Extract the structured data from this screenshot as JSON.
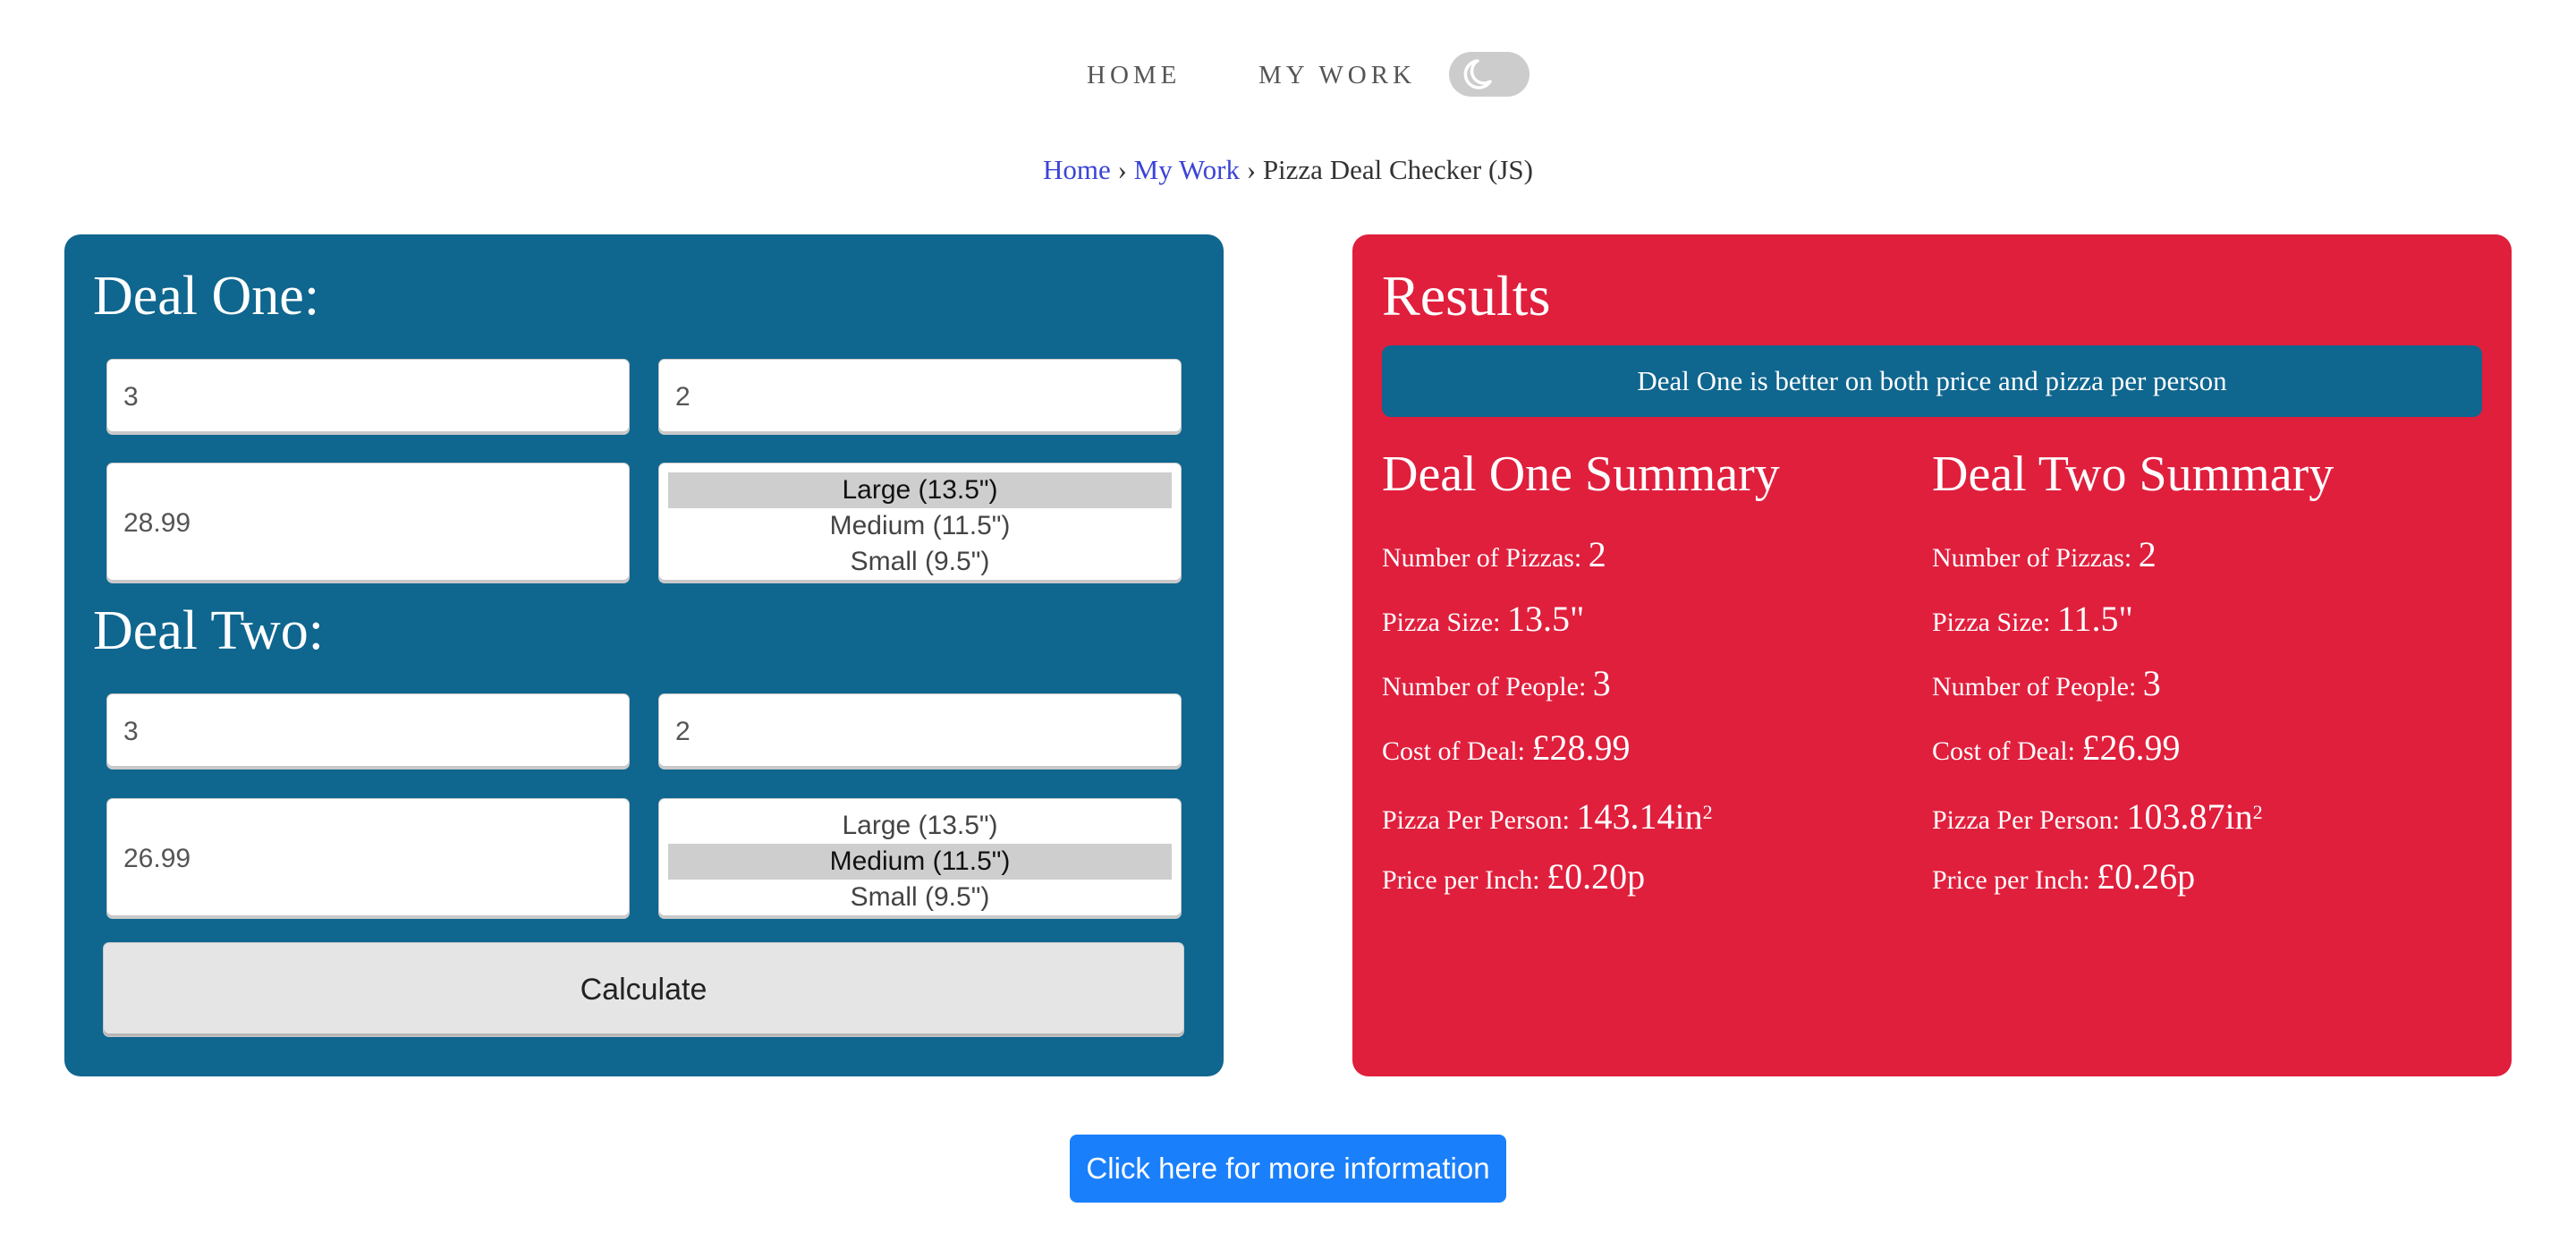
{
  "nav": {
    "items": [
      {
        "label": "HOME"
      },
      {
        "label": "MY WORK"
      }
    ],
    "theme_toggle_icon": "moon-icon"
  },
  "breadcrumb": {
    "items": [
      {
        "label": "Home",
        "link": true
      },
      {
        "label": "My Work",
        "link": true
      },
      {
        "label": "Pizza Deal Checker (JS)",
        "link": false
      }
    ],
    "separator": "›"
  },
  "deal_one": {
    "title": "Deal One:",
    "people": "3",
    "pizzas": "2",
    "price": "28.99",
    "size_options": [
      "Large (13.5\")",
      "Medium (11.5\")",
      "Small (9.5\")"
    ],
    "selected_size": "Large (13.5\")"
  },
  "deal_two": {
    "title": "Deal Two:",
    "people": "3",
    "pizzas": "2",
    "price": "26.99",
    "size_options": [
      "Large (13.5\")",
      "Medium (11.5\")",
      "Small (9.5\")"
    ],
    "selected_size": "Medium (11.5\")"
  },
  "calculate_label": "Calculate",
  "results": {
    "title": "Results",
    "verdict": "Deal One is better on both price and pizza per person",
    "summaries": [
      {
        "title": "Deal One Summary",
        "items": [
          {
            "label": "Number of Pizzas:",
            "value": "2",
            "sup": ""
          },
          {
            "label": "Pizza Size:",
            "value": "13.5\"",
            "sup": ""
          },
          {
            "label": "Number of People:",
            "value": "3",
            "sup": ""
          },
          {
            "label": "Cost of Deal:",
            "value": "£28.99",
            "sup": ""
          },
          {
            "label": "Pizza Per Person:",
            "value": "143.14in",
            "sup": "2"
          },
          {
            "label": "Price per Inch:",
            "value": "£0.20p",
            "sup": ""
          }
        ]
      },
      {
        "title": "Deal Two Summary",
        "items": [
          {
            "label": "Number of Pizzas:",
            "value": "2",
            "sup": ""
          },
          {
            "label": "Pizza Size:",
            "value": "11.5\"",
            "sup": ""
          },
          {
            "label": "Number of People:",
            "value": "3",
            "sup": ""
          },
          {
            "label": "Cost of Deal:",
            "value": "£26.99",
            "sup": ""
          },
          {
            "label": "Pizza Per Person:",
            "value": "103.87in",
            "sup": "2"
          },
          {
            "label": "Price per Inch:",
            "value": "£0.26p",
            "sup": ""
          }
        ]
      }
    ]
  },
  "info_button_label": "Click here for more information",
  "colors": {
    "deal_panel": "#0f668f",
    "results_panel": "#e01f3d",
    "info_button": "#1a7ffb",
    "link": "#3b44d6"
  }
}
